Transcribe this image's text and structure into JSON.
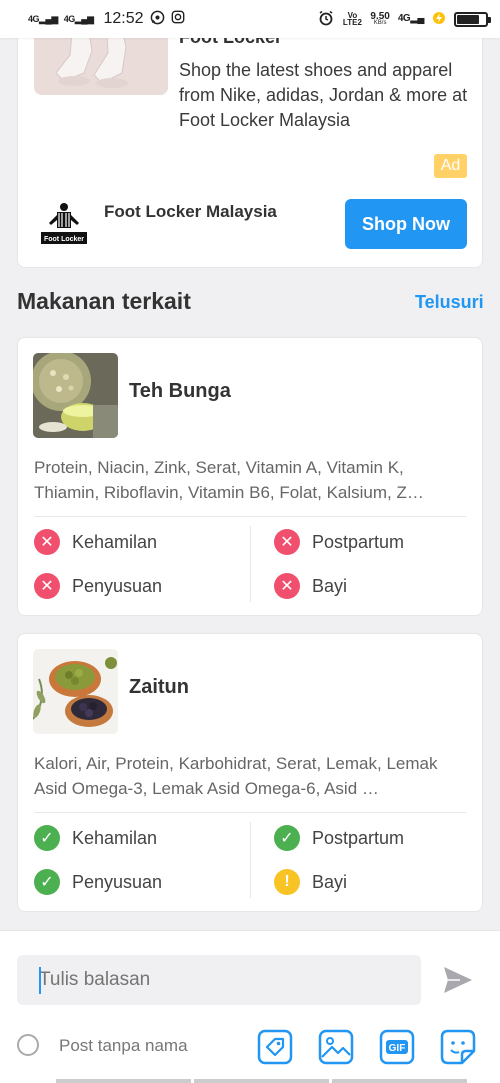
{
  "status_bar": {
    "signal1": "4G",
    "signal2": "4G",
    "time": "12:52",
    "net_speed": "9.50",
    "net_unit": "KB/s",
    "volte": "Vo LTE2",
    "net_type": "4G"
  },
  "ad": {
    "headline": "Foot Locker",
    "description": "Shop the latest shoes and apparel from Nike, adidas, Jordan & more at Foot Locker Malaysia",
    "badge": "Ad",
    "brand": "Foot Locker Malaysia",
    "cta": "Shop Now",
    "logo_text": "Foot Locker"
  },
  "section": {
    "title": "Makanan terkait",
    "link": "Telusuri"
  },
  "foods": [
    {
      "name": "Teh Bunga",
      "nutrients": "Protein, Niacin, Zink, Serat, Vitamin A, Vitamin K, Thiamin, Riboflavin, Vitamin B6, Folat, Kalsium, Z…",
      "statuses": [
        {
          "label": "Kehamilan",
          "state": "no"
        },
        {
          "label": "Postpartum",
          "state": "no"
        },
        {
          "label": "Penyusuan",
          "state": "no"
        },
        {
          "label": "Bayi",
          "state": "no"
        }
      ]
    },
    {
      "name": "Zaitun",
      "nutrients": "Kalori, Air, Protein, Karbohidrat, Serat, Lemak, Lemak Asid Omega-3, Lemak Asid Omega-6, Asid …",
      "statuses": [
        {
          "label": "Kehamilan",
          "state": "yes"
        },
        {
          "label": "Postpartum",
          "state": "yes"
        },
        {
          "label": "Penyusuan",
          "state": "yes"
        },
        {
          "label": "Bayi",
          "state": "caution"
        }
      ]
    }
  ],
  "reply": {
    "placeholder": "Tulis balasan",
    "anon_label": "Post tanpa nama",
    "gif_label": "GIF"
  },
  "colors": {
    "accent": "#2196f3",
    "no": "#f0506e",
    "yes": "#4cb050",
    "caution": "#f7c325",
    "ad_badge": "#ffd166"
  }
}
